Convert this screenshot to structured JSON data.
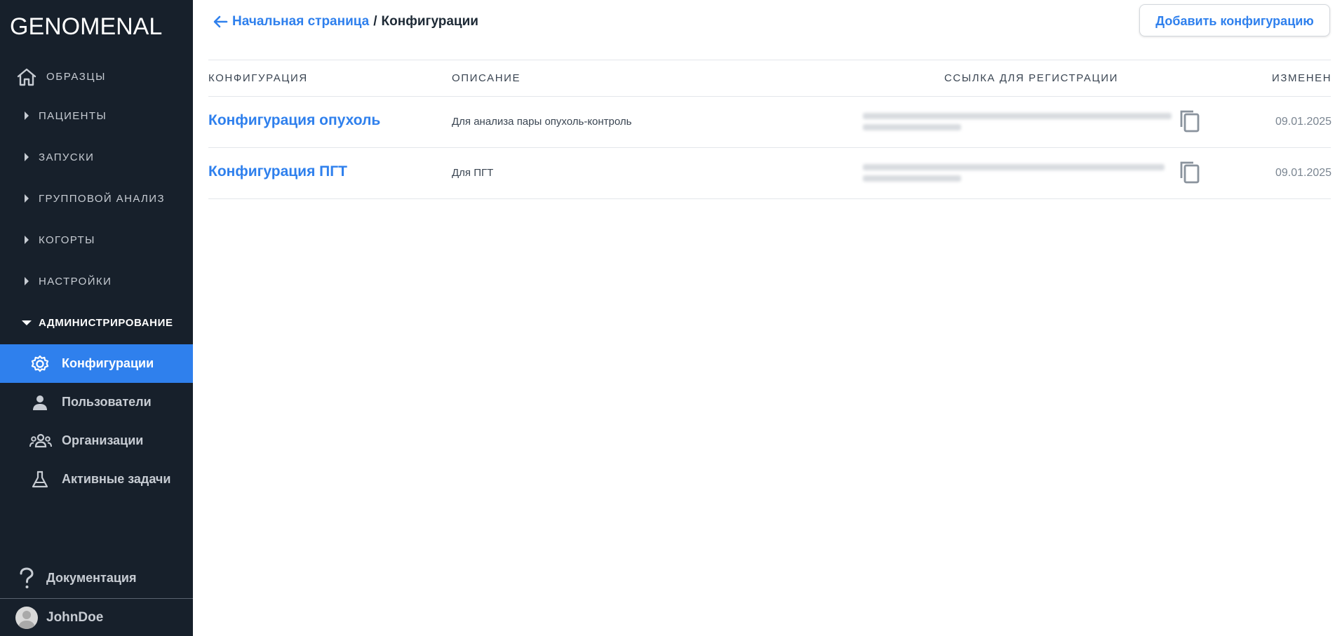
{
  "app": {
    "logo": "GENOMENAL"
  },
  "sidebar": {
    "top_item": {
      "label": "ОБРАЗЦЫ",
      "icon": "home-icon"
    },
    "groups": [
      {
        "label": "ПАЦИЕНТЫ",
        "expanded": false
      },
      {
        "label": "ЗАПУСКИ",
        "expanded": false
      },
      {
        "label": "ГРУППОВОЙ АНАЛИЗ",
        "expanded": false
      },
      {
        "label": "КОГОРТЫ",
        "expanded": false
      },
      {
        "label": "НАСТРОЙКИ",
        "expanded": false
      },
      {
        "label": "АДМИНИСТРИРОВАНИЕ",
        "expanded": true
      }
    ],
    "admin_items": [
      {
        "label": "Конфигурации",
        "icon": "gear-icon",
        "active": true
      },
      {
        "label": "Пользователи",
        "icon": "person-icon",
        "active": false
      },
      {
        "label": "Организации",
        "icon": "group-icon",
        "active": false
      },
      {
        "label": "Активные задачи",
        "icon": "flask-icon",
        "active": false
      }
    ],
    "documentation": {
      "label": "Документация",
      "icon": "help-icon"
    },
    "user": {
      "name": "JohnDoe",
      "icon": "avatar-icon"
    }
  },
  "header": {
    "breadcrumb_home": "Начальная страница",
    "breadcrumb_sep": "/",
    "breadcrumb_current": "Конфигурации",
    "add_button": "Добавить конфигурацию"
  },
  "table": {
    "columns": [
      "КОНФИГУРАЦИЯ",
      "ОПИСАНИЕ",
      "ССЫЛКА ДЛЯ РЕГИСТРАЦИИ",
      "ИЗМЕНЕН"
    ],
    "rows": [
      {
        "name": "Конфигурация опухоль",
        "description": "Для анализа пары опухоль-контроль",
        "date": "09.01.2025"
      },
      {
        "name": "Конфигурация ПГТ",
        "description": "Для ПГТ",
        "date": "09.01.2025"
      }
    ]
  },
  "colors": {
    "sidebar_bg": "#17202b",
    "accent": "#2f80ed",
    "text_dark": "#1e2a36",
    "muted": "#7a8591"
  }
}
